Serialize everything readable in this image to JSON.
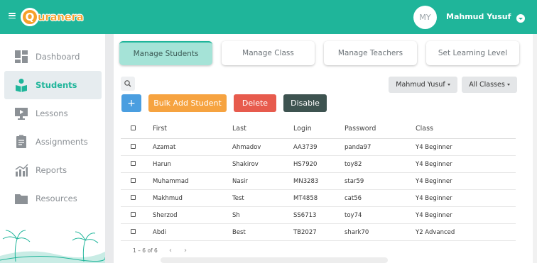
{
  "header": {
    "logo_initial": "Q",
    "logo_text": "uranera",
    "avatar_initials": "MY",
    "user_name": "Mahmud Yusuf",
    "accent": "#1fb59a",
    "logo_color": "#f6a02a"
  },
  "sidebar": {
    "items": [
      {
        "label": "Dashboard",
        "icon": "dashboard-icon"
      },
      {
        "label": "Students",
        "icon": "student-icon"
      },
      {
        "label": "Lessons",
        "icon": "screen-icon"
      },
      {
        "label": "Assignments",
        "icon": "clipboard-icon"
      },
      {
        "label": "Reports",
        "icon": "chart-icon"
      },
      {
        "label": "Resources",
        "icon": "folder-icon"
      }
    ],
    "active": "Students"
  },
  "tabs": [
    "Manage Students",
    "Manage Class",
    "Manage Teachers",
    "Set Learning Level"
  ],
  "filters": {
    "teacher": "Mahmud Yusuf",
    "classes": "All Classes"
  },
  "actions": {
    "add": "+",
    "bulk_add": "Bulk Add Student",
    "delete": "Delete",
    "disable": "Disable",
    "colors": {
      "add": "#4a9ee0",
      "bulk": "#f6a340",
      "delete": "#e75b4d",
      "disable": "#3d5350"
    }
  },
  "table": {
    "columns": [
      "First",
      "Last",
      "Login",
      "Password",
      "Class"
    ],
    "rows": [
      [
        "Azamat",
        "Ahmadov",
        "AA3739",
        "panda97",
        "Y4 Beginner"
      ],
      [
        "Harun",
        "Shakirov",
        "HS7920",
        "toy82",
        "Y4 Beginner"
      ],
      [
        "Muhammad",
        "Nasir",
        "MN3283",
        "star59",
        "Y4 Beginner"
      ],
      [
        "Makhmud",
        "Test",
        "MT4858",
        "cat56",
        "Y4 Beginner"
      ],
      [
        "Sherzod",
        "Sh",
        "SS6713",
        "toy74",
        "Y4 Beginner"
      ],
      [
        "Abdi",
        "Best",
        "TB2027",
        "shark70",
        "Y2 Advanced"
      ]
    ]
  },
  "pagination": {
    "range": "1 – 6 of 6"
  }
}
